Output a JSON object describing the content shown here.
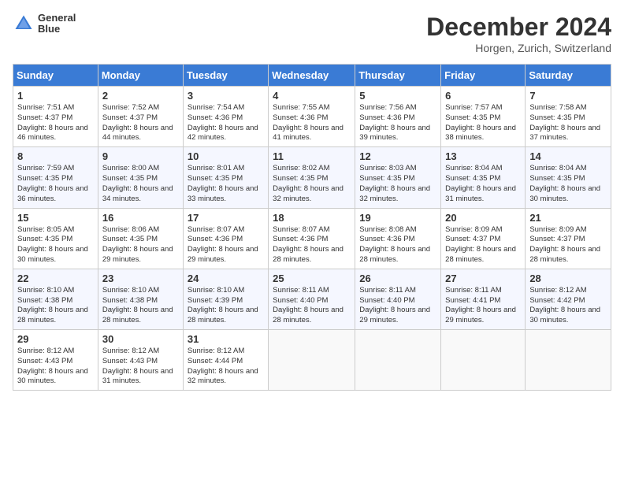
{
  "header": {
    "logo_line1": "General",
    "logo_line2": "Blue",
    "month": "December 2024",
    "location": "Horgen, Zurich, Switzerland"
  },
  "days_of_week": [
    "Sunday",
    "Monday",
    "Tuesday",
    "Wednesday",
    "Thursday",
    "Friday",
    "Saturday"
  ],
  "weeks": [
    [
      {
        "day": "1",
        "sunrise": "Sunrise: 7:51 AM",
        "sunset": "Sunset: 4:37 PM",
        "daylight": "Daylight: 8 hours and 46 minutes."
      },
      {
        "day": "2",
        "sunrise": "Sunrise: 7:52 AM",
        "sunset": "Sunset: 4:37 PM",
        "daylight": "Daylight: 8 hours and 44 minutes."
      },
      {
        "day": "3",
        "sunrise": "Sunrise: 7:54 AM",
        "sunset": "Sunset: 4:36 PM",
        "daylight": "Daylight: 8 hours and 42 minutes."
      },
      {
        "day": "4",
        "sunrise": "Sunrise: 7:55 AM",
        "sunset": "Sunset: 4:36 PM",
        "daylight": "Daylight: 8 hours and 41 minutes."
      },
      {
        "day": "5",
        "sunrise": "Sunrise: 7:56 AM",
        "sunset": "Sunset: 4:36 PM",
        "daylight": "Daylight: 8 hours and 39 minutes."
      },
      {
        "day": "6",
        "sunrise": "Sunrise: 7:57 AM",
        "sunset": "Sunset: 4:35 PM",
        "daylight": "Daylight: 8 hours and 38 minutes."
      },
      {
        "day": "7",
        "sunrise": "Sunrise: 7:58 AM",
        "sunset": "Sunset: 4:35 PM",
        "daylight": "Daylight: 8 hours and 37 minutes."
      }
    ],
    [
      {
        "day": "8",
        "sunrise": "Sunrise: 7:59 AM",
        "sunset": "Sunset: 4:35 PM",
        "daylight": "Daylight: 8 hours and 36 minutes."
      },
      {
        "day": "9",
        "sunrise": "Sunrise: 8:00 AM",
        "sunset": "Sunset: 4:35 PM",
        "daylight": "Daylight: 8 hours and 34 minutes."
      },
      {
        "day": "10",
        "sunrise": "Sunrise: 8:01 AM",
        "sunset": "Sunset: 4:35 PM",
        "daylight": "Daylight: 8 hours and 33 minutes."
      },
      {
        "day": "11",
        "sunrise": "Sunrise: 8:02 AM",
        "sunset": "Sunset: 4:35 PM",
        "daylight": "Daylight: 8 hours and 32 minutes."
      },
      {
        "day": "12",
        "sunrise": "Sunrise: 8:03 AM",
        "sunset": "Sunset: 4:35 PM",
        "daylight": "Daylight: 8 hours and 32 minutes."
      },
      {
        "day": "13",
        "sunrise": "Sunrise: 8:04 AM",
        "sunset": "Sunset: 4:35 PM",
        "daylight": "Daylight: 8 hours and 31 minutes."
      },
      {
        "day": "14",
        "sunrise": "Sunrise: 8:04 AM",
        "sunset": "Sunset: 4:35 PM",
        "daylight": "Daylight: 8 hours and 30 minutes."
      }
    ],
    [
      {
        "day": "15",
        "sunrise": "Sunrise: 8:05 AM",
        "sunset": "Sunset: 4:35 PM",
        "daylight": "Daylight: 8 hours and 30 minutes."
      },
      {
        "day": "16",
        "sunrise": "Sunrise: 8:06 AM",
        "sunset": "Sunset: 4:35 PM",
        "daylight": "Daylight: 8 hours and 29 minutes."
      },
      {
        "day": "17",
        "sunrise": "Sunrise: 8:07 AM",
        "sunset": "Sunset: 4:36 PM",
        "daylight": "Daylight: 8 hours and 29 minutes."
      },
      {
        "day": "18",
        "sunrise": "Sunrise: 8:07 AM",
        "sunset": "Sunset: 4:36 PM",
        "daylight": "Daylight: 8 hours and 28 minutes."
      },
      {
        "day": "19",
        "sunrise": "Sunrise: 8:08 AM",
        "sunset": "Sunset: 4:36 PM",
        "daylight": "Daylight: 8 hours and 28 minutes."
      },
      {
        "day": "20",
        "sunrise": "Sunrise: 8:09 AM",
        "sunset": "Sunset: 4:37 PM",
        "daylight": "Daylight: 8 hours and 28 minutes."
      },
      {
        "day": "21",
        "sunrise": "Sunrise: 8:09 AM",
        "sunset": "Sunset: 4:37 PM",
        "daylight": "Daylight: 8 hours and 28 minutes."
      }
    ],
    [
      {
        "day": "22",
        "sunrise": "Sunrise: 8:10 AM",
        "sunset": "Sunset: 4:38 PM",
        "daylight": "Daylight: 8 hours and 28 minutes."
      },
      {
        "day": "23",
        "sunrise": "Sunrise: 8:10 AM",
        "sunset": "Sunset: 4:38 PM",
        "daylight": "Daylight: 8 hours and 28 minutes."
      },
      {
        "day": "24",
        "sunrise": "Sunrise: 8:10 AM",
        "sunset": "Sunset: 4:39 PM",
        "daylight": "Daylight: 8 hours and 28 minutes."
      },
      {
        "day": "25",
        "sunrise": "Sunrise: 8:11 AM",
        "sunset": "Sunset: 4:40 PM",
        "daylight": "Daylight: 8 hours and 28 minutes."
      },
      {
        "day": "26",
        "sunrise": "Sunrise: 8:11 AM",
        "sunset": "Sunset: 4:40 PM",
        "daylight": "Daylight: 8 hours and 29 minutes."
      },
      {
        "day": "27",
        "sunrise": "Sunrise: 8:11 AM",
        "sunset": "Sunset: 4:41 PM",
        "daylight": "Daylight: 8 hours and 29 minutes."
      },
      {
        "day": "28",
        "sunrise": "Sunrise: 8:12 AM",
        "sunset": "Sunset: 4:42 PM",
        "daylight": "Daylight: 8 hours and 30 minutes."
      }
    ],
    [
      {
        "day": "29",
        "sunrise": "Sunrise: 8:12 AM",
        "sunset": "Sunset: 4:43 PM",
        "daylight": "Daylight: 8 hours and 30 minutes."
      },
      {
        "day": "30",
        "sunrise": "Sunrise: 8:12 AM",
        "sunset": "Sunset: 4:43 PM",
        "daylight": "Daylight: 8 hours and 31 minutes."
      },
      {
        "day": "31",
        "sunrise": "Sunrise: 8:12 AM",
        "sunset": "Sunset: 4:44 PM",
        "daylight": "Daylight: 8 hours and 32 minutes."
      },
      null,
      null,
      null,
      null
    ]
  ]
}
